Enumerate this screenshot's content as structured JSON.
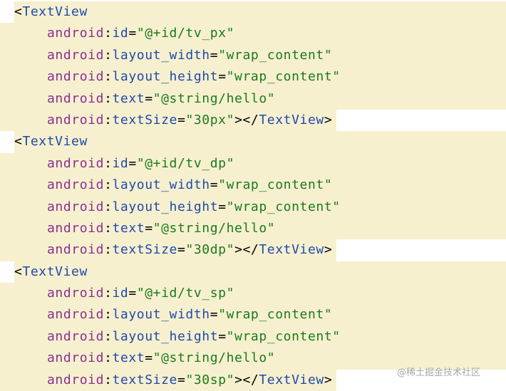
{
  "code": {
    "blocks": [
      {
        "tag": "TextView",
        "attrs": [
          {
            "ns": "android",
            "name": "id",
            "value": "\"@+id/tv_px\""
          },
          {
            "ns": "android",
            "name": "layout_width",
            "value": "\"wrap_content\""
          },
          {
            "ns": "android",
            "name": "layout_height",
            "value": "\"wrap_content\""
          },
          {
            "ns": "android",
            "name": "text",
            "value": "\"@string/hello\""
          },
          {
            "ns": "android",
            "name": "textSize",
            "value": "\"30px\""
          }
        ],
        "close_tag": "TextView"
      },
      {
        "tag": "TextView",
        "attrs": [
          {
            "ns": "android",
            "name": "id",
            "value": "\"@+id/tv_dp\""
          },
          {
            "ns": "android",
            "name": "layout_width",
            "value": "\"wrap_content\""
          },
          {
            "ns": "android",
            "name": "layout_height",
            "value": "\"wrap_content\""
          },
          {
            "ns": "android",
            "name": "text",
            "value": "\"@string/hello\""
          },
          {
            "ns": "android",
            "name": "textSize",
            "value": "\"30dp\""
          }
        ],
        "close_tag": "TextView"
      },
      {
        "tag": "TextView",
        "attrs": [
          {
            "ns": "android",
            "name": "id",
            "value": "\"@+id/tv_sp\""
          },
          {
            "ns": "android",
            "name": "layout_width",
            "value": "\"wrap_content\""
          },
          {
            "ns": "android",
            "name": "layout_height",
            "value": "\"wrap_content\""
          },
          {
            "ns": "android",
            "name": "text",
            "value": "\"@string/hello\""
          },
          {
            "ns": "android",
            "name": "textSize",
            "value": "\"30sp\""
          }
        ],
        "close_tag": "TextView"
      }
    ]
  },
  "watermark": "@稀土掘金技术社区",
  "colors": {
    "background": "#f6f0cf",
    "tag": "#1f4aa8",
    "namespace": "#8b2f8f",
    "attribute": "#1f4aa8",
    "value": "#1b7a1b"
  }
}
